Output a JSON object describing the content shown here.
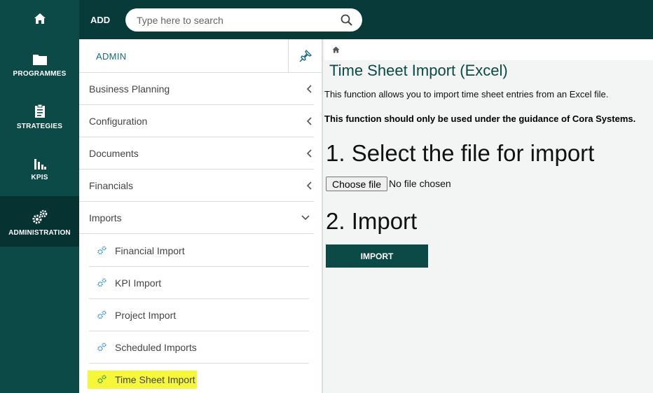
{
  "rail": {
    "items": [
      {
        "label": ""
      },
      {
        "label": "PROGRAMMES"
      },
      {
        "label": "STRATEGIES"
      },
      {
        "label": "KPIS"
      },
      {
        "label": "ADMINISTRATION"
      }
    ],
    "active": "ADMINISTRATION"
  },
  "topbar": {
    "add_label": "ADD",
    "search_placeholder": "Type here to search"
  },
  "panel": {
    "title": "ADMIN",
    "menu": [
      {
        "label": "Business Planning",
        "state": "collapsed"
      },
      {
        "label": "Configuration",
        "state": "collapsed"
      },
      {
        "label": "Documents",
        "state": "collapsed"
      },
      {
        "label": "Financials",
        "state": "collapsed"
      },
      {
        "label": "Imports",
        "state": "expanded"
      }
    ],
    "submenu": [
      {
        "label": "Financial Import"
      },
      {
        "label": "KPI Import"
      },
      {
        "label": "Project Import"
      },
      {
        "label": "Scheduled Imports"
      },
      {
        "label": "Time Sheet Import",
        "highlighted": true
      }
    ]
  },
  "main": {
    "title": "Time Sheet Import (Excel)",
    "intro": "This function allows you to import time sheet entries from an Excel file.",
    "warning": "This function should only be used under the guidance of Cora Systems.",
    "step1_heading": "1. Select the file for import",
    "choose_file_label": "Choose file",
    "no_file_text": "No file chosen",
    "step2_heading": "2. Import",
    "import_button": "IMPORT"
  },
  "colors": {
    "rail_bg": "#0b4a47",
    "topbar_bg": "#073a38",
    "accent": "#0b4a47",
    "admin_title": "#1a6a80",
    "highlight": "#f6f63a"
  }
}
